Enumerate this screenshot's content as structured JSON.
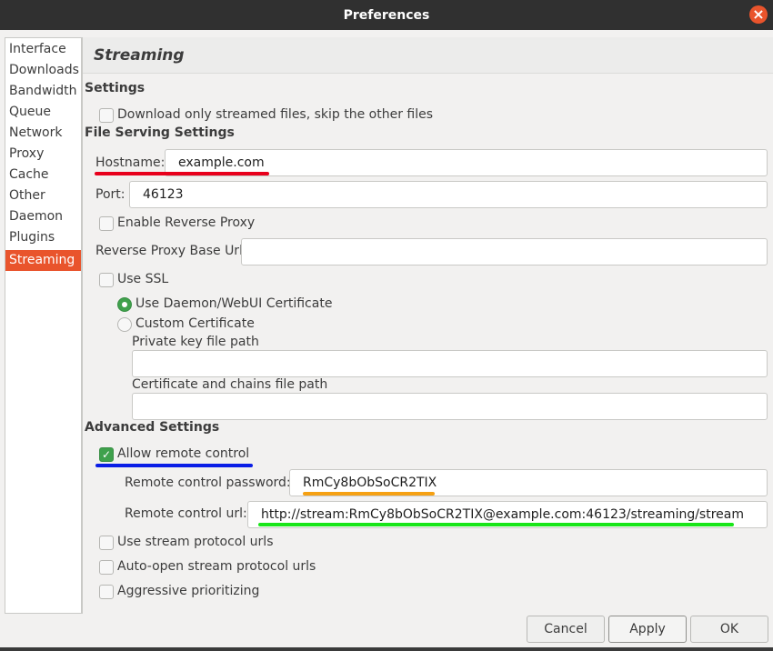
{
  "window": {
    "title": "Preferences"
  },
  "sidebar": {
    "items": [
      {
        "label": "Interface"
      },
      {
        "label": "Downloads"
      },
      {
        "label": "Bandwidth"
      },
      {
        "label": "Queue"
      },
      {
        "label": "Network"
      },
      {
        "label": "Proxy"
      },
      {
        "label": "Cache"
      },
      {
        "label": "Other"
      },
      {
        "label": "Daemon"
      },
      {
        "label": "Plugins"
      },
      {
        "label": "Streaming"
      }
    ],
    "selected": "Streaming"
  },
  "page": {
    "title": "Streaming",
    "settings": {
      "heading": "Settings",
      "download_only_streamed": {
        "label": "Download only streamed files, skip the other files",
        "checked": false
      }
    },
    "file_serving": {
      "heading": "File Serving Settings",
      "hostname": {
        "label": "Hostname:",
        "value": "example.com"
      },
      "port": {
        "label": "Port:",
        "value": "46123"
      },
      "enable_reverse_proxy": {
        "label": "Enable Reverse Proxy",
        "checked": false
      },
      "reverse_proxy_base_url": {
        "label": "Reverse Proxy Base Url:",
        "value": ""
      },
      "use_ssl": {
        "label": "Use SSL",
        "checked": false
      },
      "use_daemon_cert": {
        "label": "Use Daemon/WebUI Certificate",
        "selected": true
      },
      "custom_cert": {
        "label": "Custom Certificate",
        "selected": false
      },
      "private_key_path": {
        "label": "Private key file path",
        "value": ""
      },
      "cert_chain_path": {
        "label": "Certificate and chains file path",
        "value": ""
      }
    },
    "advanced": {
      "heading": "Advanced Settings",
      "allow_remote_control": {
        "label": "Allow remote control",
        "checked": true
      },
      "remote_password": {
        "label": "Remote control password:",
        "value": "RmCy8bObSoCR2TIX"
      },
      "remote_url": {
        "label": "Remote control url:",
        "value": "http://stream:RmCy8bObSoCR2TIX@example.com:46123/streaming/stream"
      },
      "use_stream_protocol_urls": {
        "label": "Use stream protocol urls",
        "checked": false
      },
      "auto_open_stream_protocol_urls": {
        "label": "Auto-open stream protocol urls",
        "checked": false
      },
      "aggressive_prioritizing": {
        "label": "Aggressive prioritizing",
        "checked": false
      }
    }
  },
  "buttons": {
    "cancel": "Cancel",
    "apply": "Apply",
    "ok": "OK"
  },
  "colors": {
    "accent": "#e9542c",
    "check_green": "#3fa14c",
    "annotation_red": "#e8001c",
    "annotation_blue": "#0a1ee6",
    "annotation_orange": "#f5a012",
    "annotation_green": "#19e619"
  },
  "icons": {
    "close": "close-icon",
    "check": "check-icon"
  }
}
